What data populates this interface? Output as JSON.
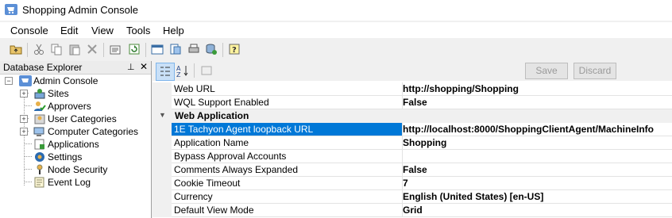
{
  "window": {
    "title": "Shopping Admin Console"
  },
  "menu": [
    "Console",
    "Edit",
    "View",
    "Tools",
    "Help"
  ],
  "explorer": {
    "title": "Database Explorer",
    "pin_glyph": "📌",
    "close_glyph": "✕",
    "tree": [
      {
        "label": "Admin Console",
        "icon": "cart-icon",
        "expanded": true
      },
      {
        "label": "Sites",
        "icon": "sites-icon",
        "expandable": true
      },
      {
        "label": "Approvers",
        "icon": "approvers-icon"
      },
      {
        "label": "User Categories",
        "icon": "user-categories-icon",
        "expandable": true
      },
      {
        "label": "Computer Categories",
        "icon": "computer-categories-icon",
        "expandable": true
      },
      {
        "label": "Applications",
        "icon": "applications-icon"
      },
      {
        "label": "Settings",
        "icon": "settings-icon",
        "selected": true
      },
      {
        "label": "Node Security",
        "icon": "node-security-icon"
      },
      {
        "label": "Event Log",
        "icon": "event-log-icon"
      }
    ]
  },
  "properties": {
    "save_label": "Save",
    "discard_label": "Discard",
    "rows": [
      {
        "name": "Web URL",
        "value": "http://shopping/Shopping"
      },
      {
        "name": "WQL Support Enabled",
        "value": "False"
      }
    ],
    "category": "Web Application",
    "category_rows": [
      {
        "name": "1E Tachyon Agent loopback URL",
        "value": "http://localhost:8000/ShoppingClientAgent/MachineInfo",
        "selected": true
      },
      {
        "name": "Application Name",
        "value": "Shopping"
      },
      {
        "name": "Bypass Approval Accounts",
        "value": ""
      },
      {
        "name": "Comments Always Expanded",
        "value": "False"
      },
      {
        "name": "Cookie Timeout",
        "value": "7"
      },
      {
        "name": "Currency",
        "value": "English (United States) [en-US]"
      },
      {
        "name": "Default View Mode",
        "value": "Grid"
      }
    ]
  },
  "colors": {
    "selection": "#0078d7",
    "category_bg": "#f0f0f0"
  }
}
